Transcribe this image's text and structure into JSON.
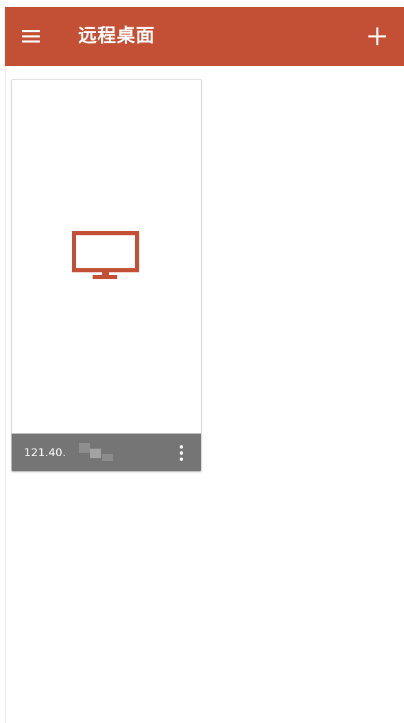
{
  "app_bar": {
    "title": "远程桌面",
    "menu_icon": "hamburger-menu-icon",
    "add_icon": "plus-icon",
    "background": "#c35034"
  },
  "connections": [
    {
      "address": "121.40.",
      "icon": "monitor-icon",
      "icon_color": "#c35034",
      "footer_color": "#757575",
      "more_icon": "more-vertical-icon"
    }
  ]
}
